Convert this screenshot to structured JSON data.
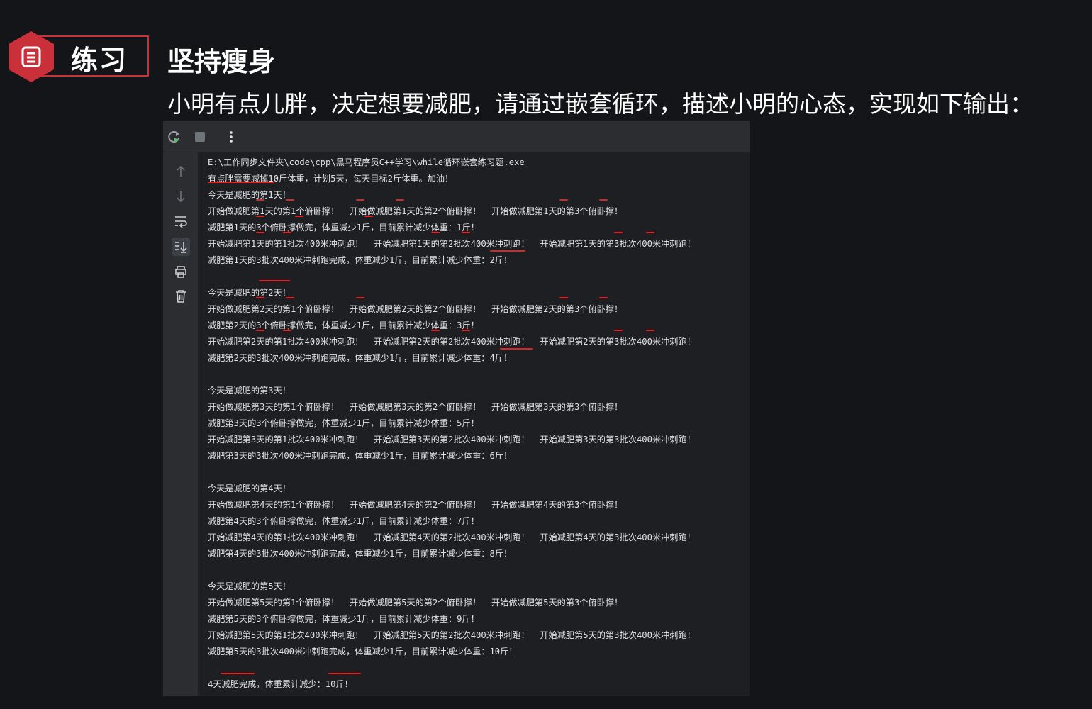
{
  "slide": {
    "badge_label": "练习",
    "title": "坚持瘦身",
    "subtitle": "小明有点儿胖，决定想要减肥，请通过嵌套循环，描述小明的心态，实现如下输出："
  },
  "toolbar": {
    "icons": [
      "rerun-icon",
      "stop-icon",
      "more-options-icon"
    ]
  },
  "gutter": {
    "icons": [
      "scroll-up-icon",
      "scroll-down-icon",
      "soft-wrap-icon",
      "scroll-to-end-icon",
      "print-icon",
      "clear-all-icon"
    ]
  },
  "console": {
    "lines": [
      "E:\\工作同步文件夹\\code\\cpp\\黑马程序员C++学习\\while循环嵌套练习题.exe",
      "有点胖需要减掉10斤体重，计划5天，每天目标2斤体重。加油！",
      "今天是减肥的第1天！",
      "开始做减肥第1天的第1个俯卧撑！  开始做减肥第1天的第2个俯卧撑！  开始做减肥第1天的第3个俯卧撑！",
      "减肥第1天的3个俯卧撑做完，体重减少1斤，目前累计减少体重：1斤！",
      "开始减肥第1天的第1批次400米冲刺跑！  开始减肥第1天的第2批次400米冲刺跑！  开始减肥第1天的第3批次400米冲刺跑！",
      "减肥第1天的3批次400米冲刺跑完成，体重减少1斤，目前累计减少体重：2斤！",
      "",
      "今天是减肥的第2天！",
      "开始做减肥第2天的第1个俯卧撑！  开始做减肥第2天的第2个俯卧撑！  开始做减肥第2天的第3个俯卧撑！",
      "减肥第2天的3个俯卧撑做完，体重减少1斤，目前累计减少体重：3斤！",
      "开始减肥第2天的第1批次400米冲刺跑！  开始减肥第2天的第2批次400米冲刺跑！  开始减肥第2天的第3批次400米冲刺跑！",
      "减肥第2天的3批次400米冲刺跑完成，体重减少1斤，目前累计减少体重：4斤！",
      "",
      "今天是减肥的第3天！",
      "开始做减肥第3天的第1个俯卧撑！  开始做减肥第3天的第2个俯卧撑！  开始做减肥第3天的第3个俯卧撑！",
      "减肥第3天的3个俯卧撑做完，体重减少1斤，目前累计减少体重：5斤！",
      "开始减肥第3天的第1批次400米冲刺跑！  开始减肥第3天的第2批次400米冲刺跑！  开始减肥第3天的第3批次400米冲刺跑！",
      "减肥第3天的3批次400米冲刺跑完成，体重减少1斤，目前累计减少体重：6斤！",
      "",
      "今天是减肥的第4天！",
      "开始做减肥第4天的第1个俯卧撑！  开始做减肥第4天的第2个俯卧撑！  开始做减肥第4天的第3个俯卧撑！",
      "减肥第4天的3个俯卧撑做完，体重减少1斤，目前累计减少体重：7斤！",
      "开始减肥第4天的第1批次400米冲刺跑！  开始减肥第4天的第2批次400米冲刺跑！  开始减肥第4天的第3批次400米冲刺跑！",
      "减肥第4天的3批次400米冲刺跑完成，体重减少1斤，目前累计减少体重：8斤！",
      "",
      "今天是减肥的第5天！",
      "开始做减肥第5天的第1个俯卧撑！  开始做减肥第5天的第2个俯卧撑！  开始做减肥第5天的第3个俯卧撑！",
      "减肥第5天的3个俯卧撑做完，体重减少1斤，目前累计减少体重：9斤！",
      "开始减肥第5天的第1批次400米冲刺跑！  开始减肥第5天的第2批次400米冲刺跑！  开始减肥第5天的第3批次400米冲刺跑！",
      "减肥第5天的3批次400米冲刺跑完成，体重减少1斤，目前累计减少体重：10斤！",
      "",
      "4天减肥完成，体重累计减少：10斤！"
    ]
  },
  "annotation_color": "#e22222"
}
